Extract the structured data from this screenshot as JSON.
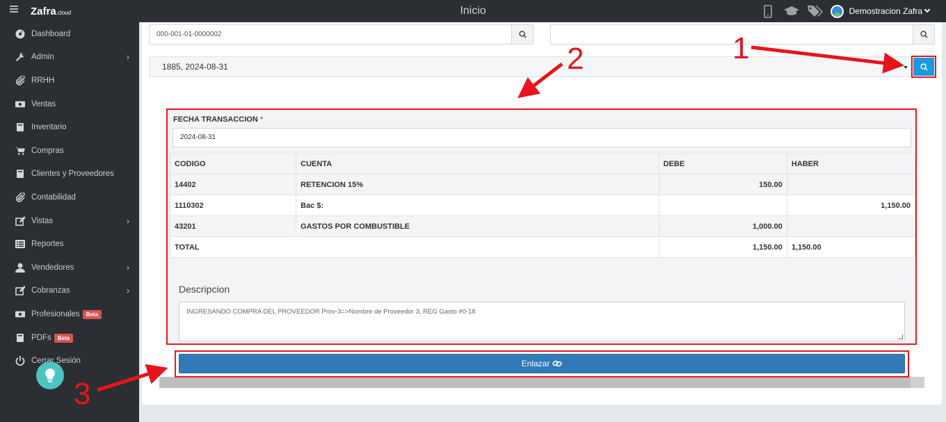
{
  "app": {
    "logo_text": "Zafra",
    "logo_suffix": ".cloud",
    "page_title": "Inicio",
    "user_name": "Demostracion Zafra",
    "user_caret": "❯"
  },
  "sidebar": {
    "items": [
      {
        "label": "Dashboard",
        "icon": "dashboard-icon",
        "has_arrow": false
      },
      {
        "label": "Admin",
        "icon": "wrench-icon",
        "has_arrow": true
      },
      {
        "label": "RRHH",
        "icon": "paperclip-icon",
        "has_arrow": false
      },
      {
        "label": "Ventas",
        "icon": "money-icon",
        "has_arrow": false
      },
      {
        "label": "Inventario",
        "icon": "book-icon",
        "has_arrow": false
      },
      {
        "label": "Compras",
        "icon": "cart-icon",
        "has_arrow": false
      },
      {
        "label": "Clientes y Proveedores",
        "icon": "book-icon",
        "has_arrow": false
      },
      {
        "label": "Contabilidad",
        "icon": "paperclip-icon",
        "has_arrow": false
      },
      {
        "label": "Vistas",
        "icon": "edit-icon",
        "has_arrow": true
      },
      {
        "label": "Reportes",
        "icon": "list-icon",
        "has_arrow": false
      },
      {
        "label": "Vendedores",
        "icon": "user-icon",
        "has_arrow": true
      },
      {
        "label": "Cobranzas",
        "icon": "edit-icon",
        "has_arrow": true
      },
      {
        "label": "Profesionales",
        "icon": "money-icon",
        "has_arrow": false,
        "badge": "Beta"
      },
      {
        "label": "PDFs",
        "icon": "book-icon",
        "has_arrow": false,
        "badge": "Beta"
      },
      {
        "label": "Cerrar Sesión",
        "icon": "power-icon",
        "has_arrow": false
      }
    ]
  },
  "search": {
    "document_value": "000-001-01-0000002",
    "second_value": ""
  },
  "select": {
    "selected": "1885, 2024-08-31"
  },
  "form": {
    "fecha_label": "FECHA TRANSACCION",
    "required_mark": "*",
    "fecha_value": "2024-08-31",
    "table": {
      "headers": [
        "CODIGO",
        "CUENTA",
        "DEBE",
        "HABER"
      ],
      "rows": [
        {
          "codigo": "14402",
          "cuenta": "RETENCION 15%",
          "debe": "150.00",
          "haber": ""
        },
        {
          "codigo": "1110302",
          "cuenta": "Bac $:",
          "debe": "",
          "haber": "1,150.00"
        },
        {
          "codigo": "43201",
          "cuenta": "GASTOS POR COMBUSTIBLE",
          "debe": "1,000.00",
          "haber": ""
        }
      ],
      "total_label": "TOTAL",
      "total_debe": "1,150.00",
      "total_haber": "1,150.00"
    },
    "descripcion_label": "Descripcion",
    "descripcion_value": "INGRESANDO COMPRA DEL PROVEEDOR Prov-3=>Nombre de Proveedor 3, REG Gasto #0-18"
  },
  "actions": {
    "enlazar_label": "Enlazar"
  },
  "annotations": {
    "numbers": [
      "1",
      "2",
      "3"
    ],
    "color": "#e8141b"
  },
  "colors": {
    "sidebar_bg": "#2b2f33",
    "primary_button": "#3279b7",
    "search_button": "#1a9ae0",
    "badge": "#d9534f"
  }
}
